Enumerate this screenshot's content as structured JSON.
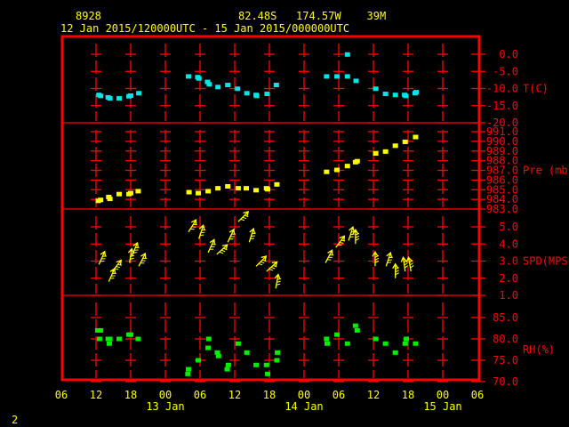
{
  "header": {
    "station_id": "8928",
    "location": "82.48S   174.57W    39M",
    "time_range": "12 Jan 2015/120000UTC - 15 Jan 2015/000000UTC"
  },
  "page_number": "2",
  "colors": {
    "frame": "#ff0000",
    "text": "#ffff00",
    "temperature": "#00e5e5",
    "pressure": "#ffff00",
    "wind": "#ffff00",
    "rh": "#00ee00"
  },
  "chart_data": {
    "type": "scatter",
    "x_unit": "hours since 12 Jan 2015 00UTC",
    "xlim": [
      6,
      78
    ],
    "x_ticks": [
      {
        "h": 6,
        "label": "06"
      },
      {
        "h": 12,
        "label": "12"
      },
      {
        "h": 18,
        "label": "18"
      },
      {
        "h": 24,
        "label": "00"
      },
      {
        "h": 30,
        "label": "06"
      },
      {
        "h": 36,
        "label": "12"
      },
      {
        "h": 42,
        "label": "18"
      },
      {
        "h": 48,
        "label": "00"
      },
      {
        "h": 54,
        "label": "06"
      },
      {
        "h": 60,
        "label": "12"
      },
      {
        "h": 66,
        "label": "18"
      },
      {
        "h": 72,
        "label": "00"
      },
      {
        "h": 78,
        "label": "06"
      }
    ],
    "date_labels": [
      {
        "h": 24,
        "label": "13 Jan"
      },
      {
        "h": 48,
        "label": "14 Jan"
      },
      {
        "h": 72,
        "label": "15 Jan"
      }
    ],
    "panels": [
      {
        "name": "T(C)",
        "ylim": [
          -20,
          0
        ],
        "ticks": [
          {
            "v": 0,
            "label": "0.0"
          },
          {
            "v": -5,
            "label": "-5.0"
          },
          {
            "v": -10,
            "label": "-10.0"
          },
          {
            "v": -15,
            "label": "-15.0"
          },
          {
            "v": -20,
            "label": "-20.0"
          }
        ],
        "points": [
          [
            12.5,
            -12.0
          ],
          [
            12.8,
            -12.3
          ],
          [
            14.1,
            -12.7
          ],
          [
            14.4,
            -13.0
          ],
          [
            16.0,
            -13.0
          ],
          [
            17.7,
            -12.4
          ],
          [
            18.0,
            -12.2
          ],
          [
            19.4,
            -11.5
          ],
          [
            28.0,
            -6.6
          ],
          [
            29.6,
            -6.8
          ],
          [
            29.8,
            -7.2
          ],
          [
            31.3,
            -8.2
          ],
          [
            31.6,
            -8.9
          ],
          [
            33.1,
            -9.7
          ],
          [
            34.8,
            -9.1
          ],
          [
            36.5,
            -10.2
          ],
          [
            38.1,
            -11.5
          ],
          [
            39.7,
            -12.0
          ],
          [
            39.8,
            -12.3
          ],
          [
            41.6,
            -11.7
          ],
          [
            43.2,
            -9.1
          ],
          [
            51.9,
            -6.6
          ],
          [
            53.7,
            -6.6
          ],
          [
            55.5,
            -0.2
          ],
          [
            55.5,
            -6.6
          ],
          [
            57.0,
            -7.9
          ],
          [
            60.4,
            -10.2
          ],
          [
            62.1,
            -11.7
          ],
          [
            63.8,
            -12.0
          ],
          [
            65.4,
            -12.0
          ],
          [
            65.6,
            -12.3
          ],
          [
            67.2,
            -11.5
          ],
          [
            67.4,
            -11.2
          ]
        ]
      },
      {
        "name": "Pre (mb)",
        "ylim": [
          983,
          991
        ],
        "ticks": [
          {
            "v": 991,
            "label": "991.0"
          },
          {
            "v": 990,
            "label": "990.0"
          },
          {
            "v": 989,
            "label": "989.0"
          },
          {
            "v": 988,
            "label": "988.0"
          },
          {
            "v": 987,
            "label": "987.0"
          },
          {
            "v": 986,
            "label": "986.0"
          },
          {
            "v": 985,
            "label": "985.0"
          },
          {
            "v": 984,
            "label": "984.0"
          },
          {
            "v": 983,
            "label": "983.0"
          }
        ],
        "points": [
          [
            12.4,
            983.8
          ],
          [
            12.8,
            983.9
          ],
          [
            14.2,
            984.2
          ],
          [
            14.4,
            984.0
          ],
          [
            16.0,
            984.5
          ],
          [
            17.7,
            984.5
          ],
          [
            18.0,
            984.6
          ],
          [
            19.3,
            984.8
          ],
          [
            28.1,
            984.7
          ],
          [
            29.7,
            984.6
          ],
          [
            31.4,
            984.8
          ],
          [
            33.1,
            985.1
          ],
          [
            34.8,
            985.3
          ],
          [
            36.6,
            985.1
          ],
          [
            38.0,
            985.1
          ],
          [
            39.7,
            984.9
          ],
          [
            41.5,
            985.1
          ],
          [
            41.7,
            985.0
          ],
          [
            43.3,
            985.5
          ],
          [
            51.9,
            986.8
          ],
          [
            53.7,
            987.0
          ],
          [
            55.5,
            987.4
          ],
          [
            56.9,
            987.8
          ],
          [
            57.2,
            987.9
          ],
          [
            60.4,
            988.7
          ],
          [
            62.1,
            988.9
          ],
          [
            63.8,
            989.5
          ],
          [
            65.5,
            989.9
          ],
          [
            67.3,
            990.4
          ]
        ]
      },
      {
        "name": "SPD(MPS)",
        "ylim": [
          1,
          5
        ],
        "ticks": [
          {
            "v": 5,
            "label": "5.0"
          },
          {
            "v": 4,
            "label": "4.0"
          },
          {
            "v": 3,
            "label": "3.0"
          },
          {
            "v": 2,
            "label": "2.0"
          },
          {
            "v": 1,
            "label": "1.0"
          }
        ],
        "wind_vectors": [
          [
            12.5,
            2.8,
            24
          ],
          [
            14.2,
            1.8,
            24
          ],
          [
            14.8,
            2.4,
            39
          ],
          [
            17.8,
            2.9,
            9
          ],
          [
            18.2,
            3.3,
            23
          ],
          [
            19.4,
            2.7,
            27
          ],
          [
            28.0,
            4.7,
            32
          ],
          [
            29.8,
            4.3,
            18
          ],
          [
            31.4,
            3.5,
            25
          ],
          [
            32.9,
            3.4,
            48
          ],
          [
            34.8,
            4.1,
            25
          ],
          [
            36.6,
            5.3,
            45
          ],
          [
            38.5,
            4.1,
            18
          ],
          [
            39.7,
            2.7,
            45
          ],
          [
            41.5,
            2.4,
            48
          ],
          [
            43.1,
            1.4,
            10
          ],
          [
            51.7,
            2.9,
            28
          ],
          [
            53.5,
            3.8,
            37
          ],
          [
            55.7,
            4.2,
            18
          ],
          [
            56.9,
            4.0,
            0
          ],
          [
            60.3,
            2.7,
            0
          ],
          [
            62.2,
            2.7,
            18
          ],
          [
            63.8,
            2.0,
            0
          ],
          [
            65.5,
            2.4,
            352
          ],
          [
            66.5,
            2.4,
            350
          ]
        ]
      },
      {
        "name": "RH(%)",
        "ylim": [
          70,
          85
        ],
        "ticks": [
          {
            "v": 85,
            "label": "85.0"
          },
          {
            "v": 80,
            "label": "80.0"
          },
          {
            "v": 75,
            "label": "75.0"
          },
          {
            "v": 70,
            "label": "70.0"
          }
        ],
        "points": [
          [
            12.3,
            81.9
          ],
          [
            12.8,
            81.9
          ],
          [
            12.6,
            79.9
          ],
          [
            14.1,
            79.9
          ],
          [
            14.4,
            79.9
          ],
          [
            14.3,
            78.8
          ],
          [
            16.0,
            79.9
          ],
          [
            17.7,
            80.9
          ],
          [
            18.0,
            80.9
          ],
          [
            19.3,
            79.9
          ],
          [
            27.9,
            71.7
          ],
          [
            28.0,
            72.8
          ],
          [
            29.7,
            74.9
          ],
          [
            31.5,
            79.9
          ],
          [
            31.4,
            77.8
          ],
          [
            33.0,
            76.7
          ],
          [
            33.2,
            75.9
          ],
          [
            34.7,
            72.8
          ],
          [
            34.9,
            73.8
          ],
          [
            36.6,
            78.8
          ],
          [
            38.1,
            76.7
          ],
          [
            39.7,
            73.8
          ],
          [
            41.5,
            73.8
          ],
          [
            41.7,
            71.7
          ],
          [
            43.3,
            74.9
          ],
          [
            43.4,
            76.7
          ],
          [
            51.9,
            79.9
          ],
          [
            52.0,
            78.8
          ],
          [
            53.7,
            80.9
          ],
          [
            55.5,
            78.8
          ],
          [
            56.9,
            83.0
          ],
          [
            57.2,
            81.9
          ],
          [
            60.4,
            79.9
          ],
          [
            62.1,
            78.8
          ],
          [
            63.8,
            76.7
          ],
          [
            65.5,
            78.8
          ],
          [
            65.7,
            79.9
          ],
          [
            67.3,
            78.8
          ]
        ]
      }
    ]
  }
}
